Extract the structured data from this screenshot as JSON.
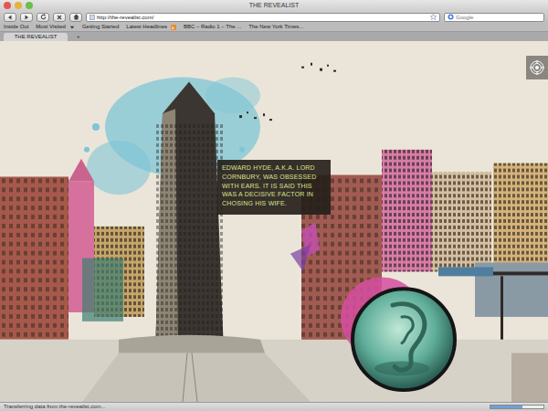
{
  "window": {
    "title": "THE REVEALIST"
  },
  "toolbar": {
    "url": "http://the-revealist.com/",
    "search_placeholder": "Google"
  },
  "bookmarks": [
    {
      "label": "Inside Out",
      "kind": "link"
    },
    {
      "label": "Most Visited",
      "kind": "menu"
    },
    {
      "label": "Getting Started",
      "kind": "link"
    },
    {
      "label": "Latest Headlines",
      "kind": "feed"
    },
    {
      "label": "BBC – Radio 1 – The ...",
      "kind": "link"
    },
    {
      "label": "The New York Times...",
      "kind": "link"
    }
  ],
  "tabs": [
    {
      "label": "THE REVEALIST",
      "selected": true
    }
  ],
  "new_tab": "+",
  "page": {
    "caption": "EDWARD HYDE, A.K.A. LORD CORNBURY, WAS OBSESSED WITH EARS. IT IS SAID THIS WAS A DECISIVE FACTOR IN CHOSING HIS WIFE."
  },
  "status_bar": {
    "text": "Transferring data from the-revealist.com...",
    "level": 0.6
  }
}
